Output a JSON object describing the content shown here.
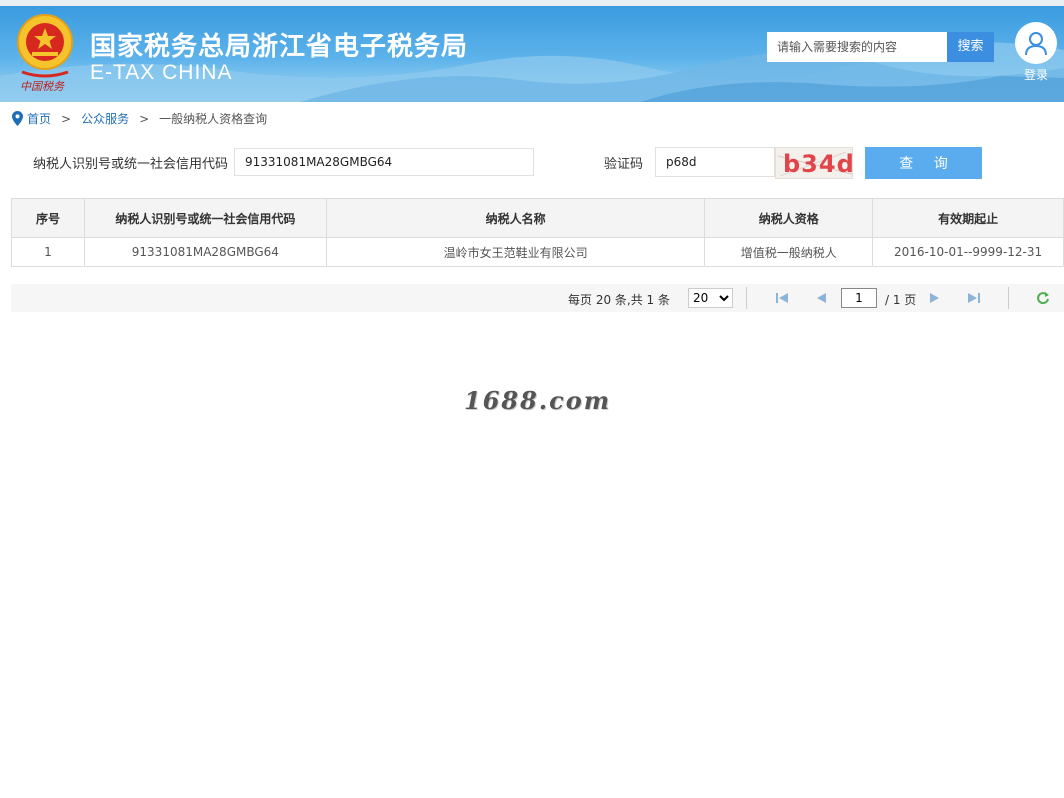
{
  "header": {
    "title": "国家税务总局浙江省电子税务局",
    "subtitle": "E-TAX CHINA",
    "search_placeholder": "请输入需要搜索的内容",
    "search_label": "搜索",
    "login_label": "登录",
    "emblem_text": "中国税务"
  },
  "breadcrumb": {
    "home": "首页",
    "sep1": ">",
    "service": "公众服务",
    "sep2": ">",
    "current": "一般纳税人资格查询"
  },
  "form": {
    "taxid_label": "纳税人识别号或统一社会信用代码",
    "taxid_value": "91331081MA28GMBG64",
    "captcha_label": "验证码",
    "captcha_value": "p68d",
    "captcha_image_text": "b34d",
    "query_label": "查 询"
  },
  "table": {
    "headers": [
      "序号",
      "纳税人识别号或统一社会信用代码",
      "纳税人名称",
      "纳税人资格",
      "有效期起止"
    ],
    "rows": [
      [
        "1",
        "91331081MA28GMBG64",
        "温岭市女王范鞋业有限公司",
        "增值税一般纳税人",
        "2016-10-01--9999-12-31"
      ]
    ]
  },
  "pager": {
    "info": "每页 20 条,共 1 条",
    "page_size": "20",
    "current_page": "1",
    "total": "/ 1 页"
  },
  "watermark": "1688.com",
  "colors": {
    "banner": "#3a9be0",
    "link": "#1f6fb8",
    "query_button": "#5aacee",
    "captcha_text": "#e0454a"
  }
}
